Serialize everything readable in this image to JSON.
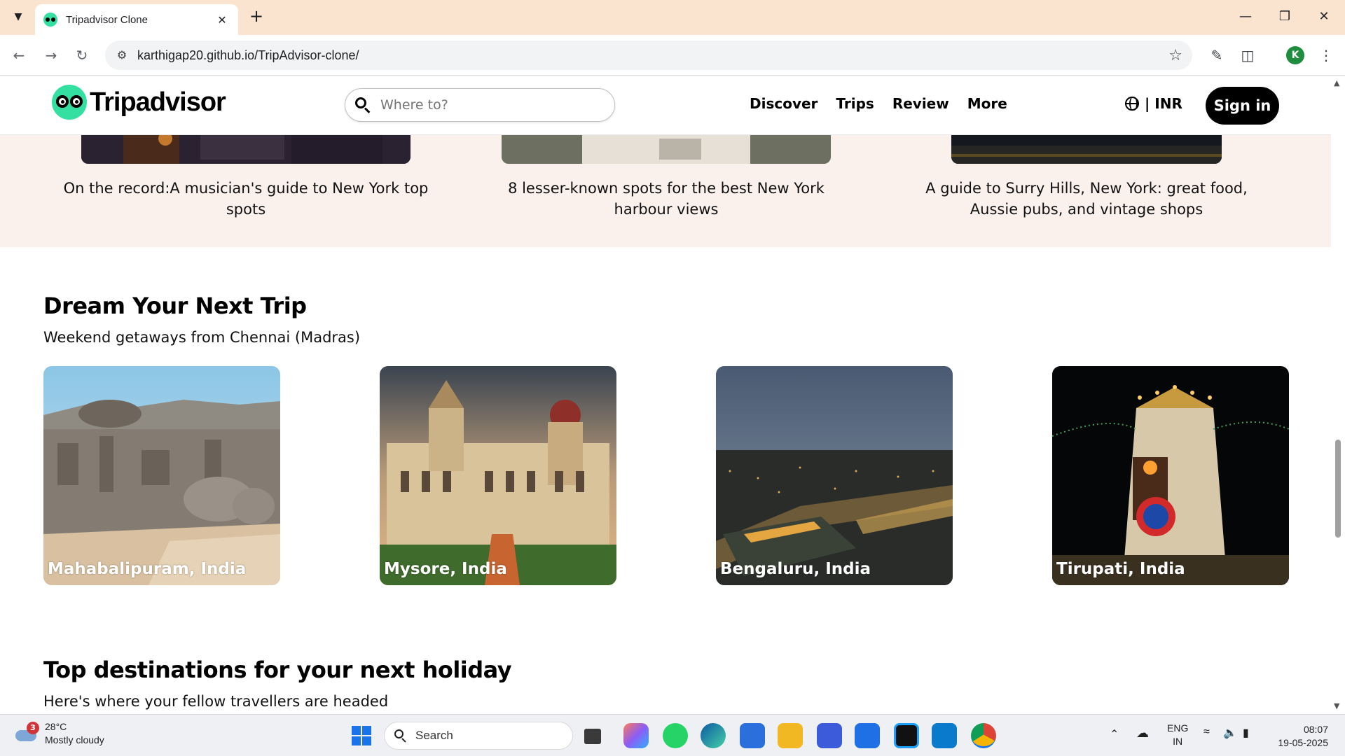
{
  "browser": {
    "tab_title": "Tripadvisor Clone",
    "url": "karthigap20.github.io/TripAdvisor-clone/"
  },
  "site": {
    "logo_text": "Tripadvisor",
    "search_placeholder": "Where to?",
    "nav": [
      "Discover",
      "Trips",
      "Review",
      "More"
    ],
    "locale": "| INR",
    "signin": "Sign in"
  },
  "articles": [
    {
      "title": "On the record:A musician's guide to New York top spots"
    },
    {
      "title": "8 lesser-known spots for the best New York harbour views"
    },
    {
      "title": "A guide to Surry Hills, New York: great food, Aussie pubs, and vintage shops"
    }
  ],
  "dream": {
    "title": "Dream Your Next Trip",
    "subtitle": "Weekend getaways from Chennai (Madras)",
    "cards": [
      {
        "label": "Mahabalipuram, India"
      },
      {
        "label": "Mysore, India"
      },
      {
        "label": "Bengaluru, India"
      },
      {
        "label": "Tirupati, India"
      }
    ]
  },
  "top": {
    "title": "Top destinations for your next holiday",
    "subtitle": "Here's where your fellow travellers are headed"
  },
  "taskbar": {
    "weather_temp": "28°C",
    "weather_desc": "Mostly cloudy",
    "weather_badge": "3",
    "search": "Search",
    "lang1": "ENG",
    "lang2": "IN",
    "time": "08:07",
    "date": "19-05-2025"
  },
  "colors": {
    "brand_green": "#34e0a1",
    "article_band": "#faf1ed",
    "tabbar": "#fbe4cf"
  }
}
